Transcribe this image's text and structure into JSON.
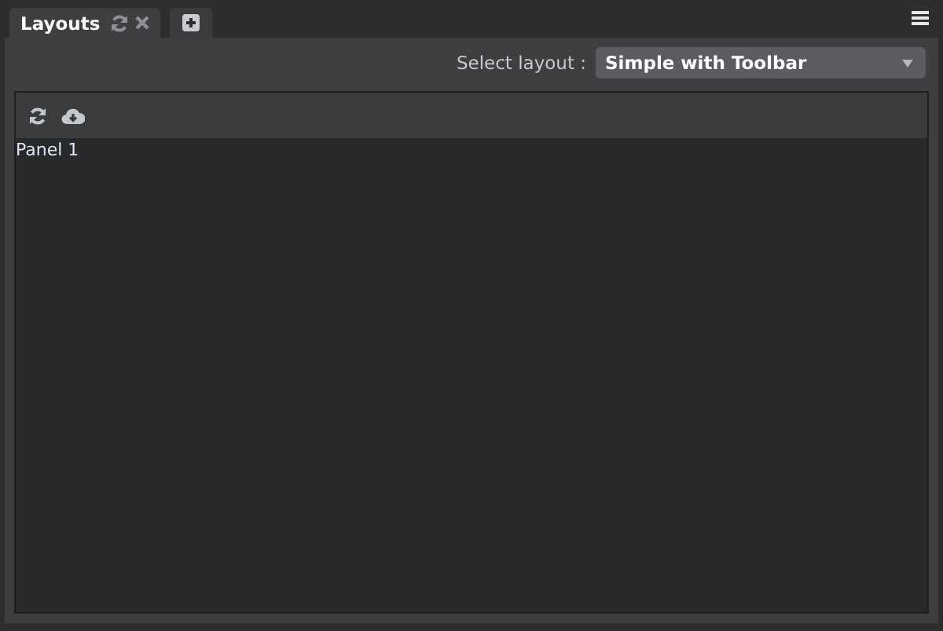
{
  "tabs": [
    {
      "label": "Layouts",
      "selected": true
    }
  ],
  "layout_selector": {
    "label": "Select layout :",
    "value": "Simple with Toolbar"
  },
  "panel": {
    "title": "Panel 1"
  }
}
